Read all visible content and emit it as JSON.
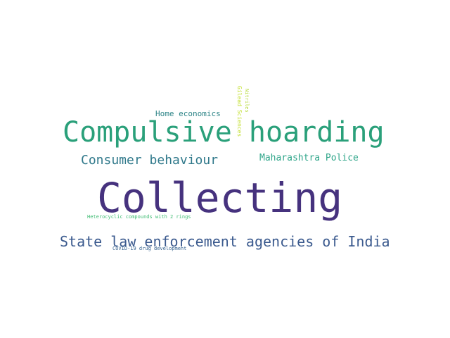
{
  "words": {
    "collecting": {
      "text": "Collecting",
      "color": "#46327e"
    },
    "compulsive_hoarding": {
      "text": "Compulsive hoarding",
      "color": "#2aa07a"
    },
    "state_law": {
      "text": "State law enforcement agencies of India",
      "color": "#3b5a8e"
    },
    "consumer_behaviour": {
      "text": "Consumer behaviour",
      "color": "#30798b"
    },
    "maharashtra_police": {
      "text": "Maharashtra Police",
      "color": "#2ea589"
    },
    "home_economics": {
      "text": "Home economics",
      "color": "#2d8487"
    },
    "gilead_sciences": {
      "text": "Gilead Sciences",
      "color": "#c2df2d"
    },
    "nitriles": {
      "text": "Nitriles",
      "color": "#b5d93b"
    },
    "heterocyclic": {
      "text": "Heterocyclic compounds with 2 rings",
      "color": "#3fbc73"
    },
    "covid_drug": {
      "text": "COVID-19 drug development",
      "color": "#33608d"
    }
  }
}
